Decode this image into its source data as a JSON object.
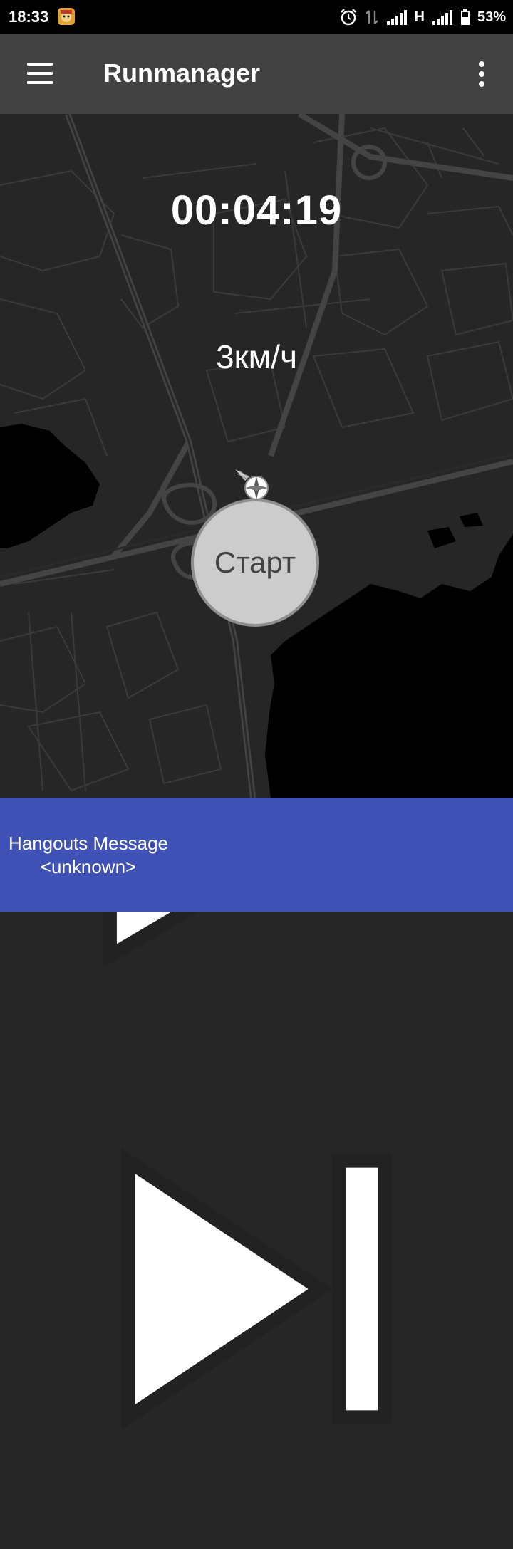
{
  "status_bar": {
    "time": "18:33",
    "network_type": "H",
    "battery": "53%",
    "icons": [
      "app-notification-icon",
      "alarm-icon",
      "data-transfer-icon",
      "signal-icon",
      "signal-icon",
      "battery-icon"
    ]
  },
  "app_bar": {
    "title": "Runmanager",
    "menu_icon": "hamburger-menu-icon",
    "overflow_icon": "more-vert-icon"
  },
  "workout": {
    "timer": "00:04:19",
    "speed": "3км/ч",
    "start_label": "Старт"
  },
  "media_player": {
    "track_title": "Hangouts Message",
    "artist": "<unknown>",
    "controls": [
      "skip-previous-icon",
      "play-icon",
      "skip-next-icon"
    ],
    "background": "#3f51b5"
  },
  "colors": {
    "map_background": "#262626",
    "map_water": "#000000",
    "app_bar": "#424242",
    "status_bar": "#000000"
  }
}
